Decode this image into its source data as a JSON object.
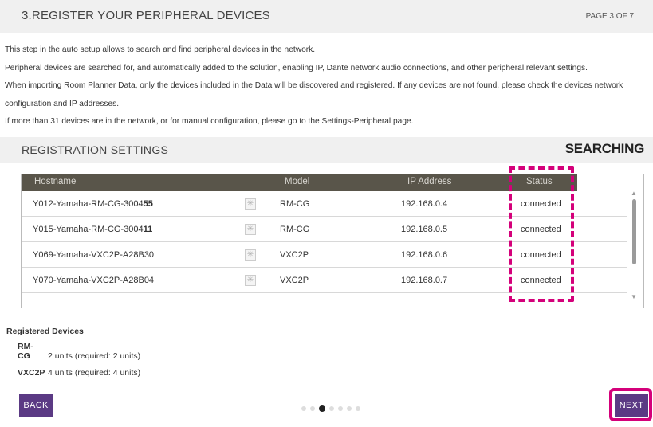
{
  "header": {
    "step_title": "3.REGISTER YOUR PERIPHERAL DEVICES",
    "page_indicator": "PAGE 3 OF 7"
  },
  "description": [
    "This step in the auto setup allows to search and find peripheral devices in the network.",
    "Peripheral devices are searched for, and automatically added to the solution, enabling IP, Dante network audio connections, and other peripheral relevant settings.",
    "When importing Room Planner Data, only the devices included in the Data will be discovered and registered. If any devices are not found, please check the devices network",
    "configuration and IP addresses.",
    "If more than 31 devices are in the network, or for manual configuration, please go to the Settings-Peripheral page."
  ],
  "section": {
    "title": "REGISTRATION SETTINGS",
    "status": "SEARCHING"
  },
  "table": {
    "columns": [
      "Hostname",
      "Model",
      "IP Address",
      "Status"
    ],
    "rows": [
      {
        "host_prefix": "Y012-Yamaha-RM-CG-3004",
        "host_suffix": "55",
        "model": "RM-CG",
        "ip": "192.168.0.4",
        "status": "connected"
      },
      {
        "host_prefix": "Y015-Yamaha-RM-CG-3004",
        "host_suffix": "11",
        "model": "RM-CG",
        "ip": "192.168.0.5",
        "status": "connected"
      },
      {
        "host_prefix": "Y069-Yamaha-VXC2P-A28B30",
        "host_suffix": "",
        "model": "VXC2P",
        "ip": "192.168.0.6",
        "status": "connected"
      },
      {
        "host_prefix": "Y070-Yamaha-VXC2P-A28B04",
        "host_suffix": "",
        "model": "VXC2P",
        "ip": "192.168.0.7",
        "status": "connected"
      }
    ],
    "row_icon": "identify-icon"
  },
  "registered": {
    "title": "Registered Devices",
    "items": [
      {
        "name": "RM-CG",
        "detail": "2 units (required: 2 units)"
      },
      {
        "name": "VXC2P",
        "detail": "4 units (required: 4 units)"
      }
    ]
  },
  "footer": {
    "back_label": "BACK",
    "next_label": "NEXT",
    "pages_total": 7,
    "current_page": 3
  },
  "colors": {
    "accent": "#5b3a84",
    "table_header": "#59554a",
    "highlight": "#d4007a"
  }
}
